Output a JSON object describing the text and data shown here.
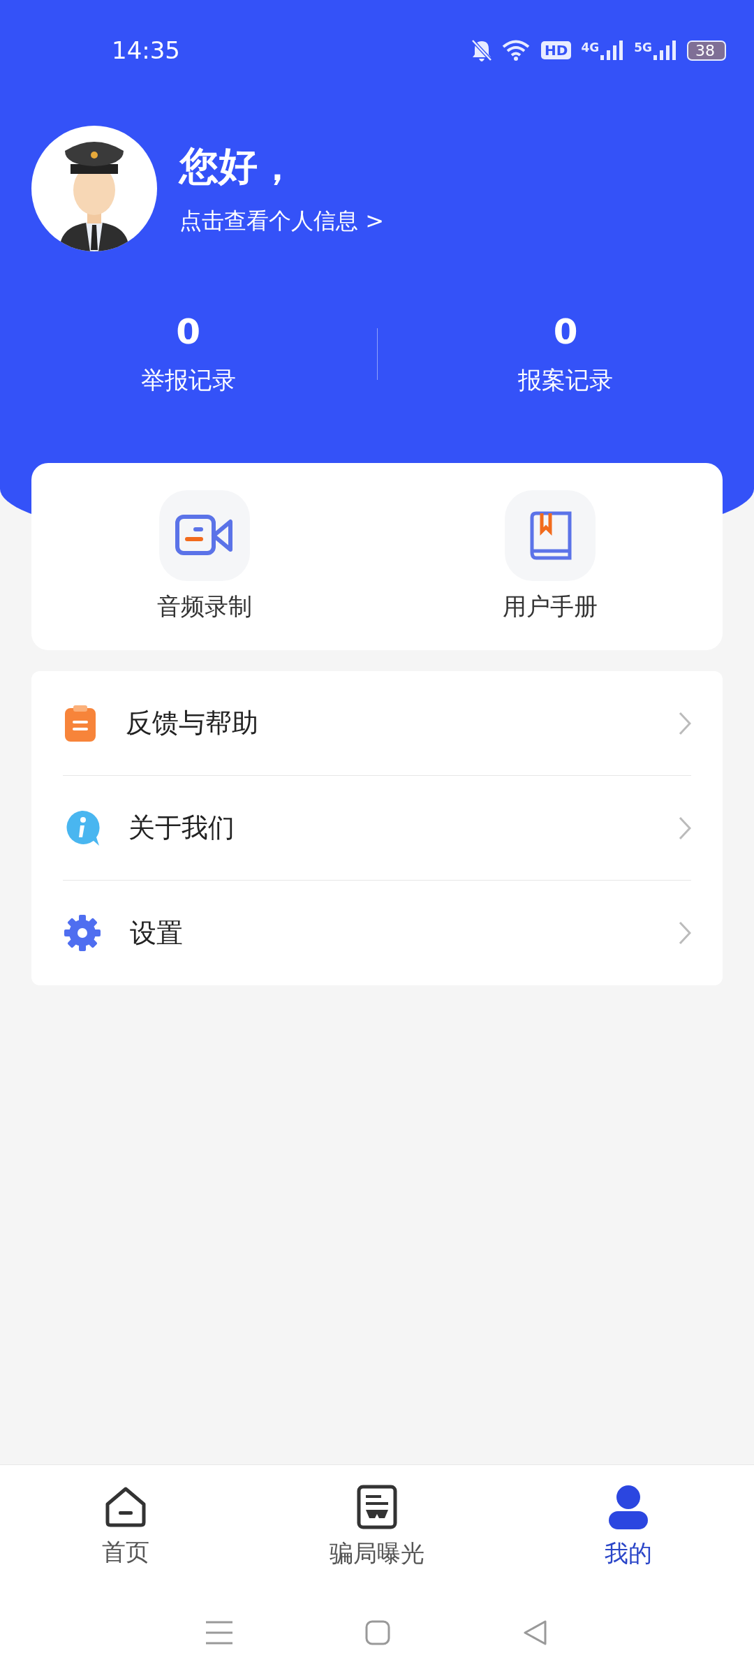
{
  "status_bar": {
    "time": "14:35",
    "hd": "HD",
    "networks": [
      "4G",
      "5G"
    ],
    "battery": "38"
  },
  "profile": {
    "greeting": "您好，",
    "link": "点击查看个人信息 >"
  },
  "stats": [
    {
      "value": "0",
      "label": "举报记录"
    },
    {
      "value": "0",
      "label": "报案记录"
    }
  ],
  "shortcuts": [
    {
      "kind": "video",
      "label": "音频录制"
    },
    {
      "kind": "book",
      "label": "用户手册"
    }
  ],
  "menu": [
    {
      "kind": "clipboard",
      "label": "反馈与帮助"
    },
    {
      "kind": "info",
      "label": "关于我们"
    },
    {
      "kind": "gear",
      "label": "设置"
    }
  ],
  "tab_bar": [
    {
      "kind": "home",
      "label": "首页",
      "selected": false
    },
    {
      "kind": "document",
      "label": "骗局曝光",
      "selected": false
    },
    {
      "kind": "person",
      "label": "我的",
      "selected": true
    }
  ]
}
